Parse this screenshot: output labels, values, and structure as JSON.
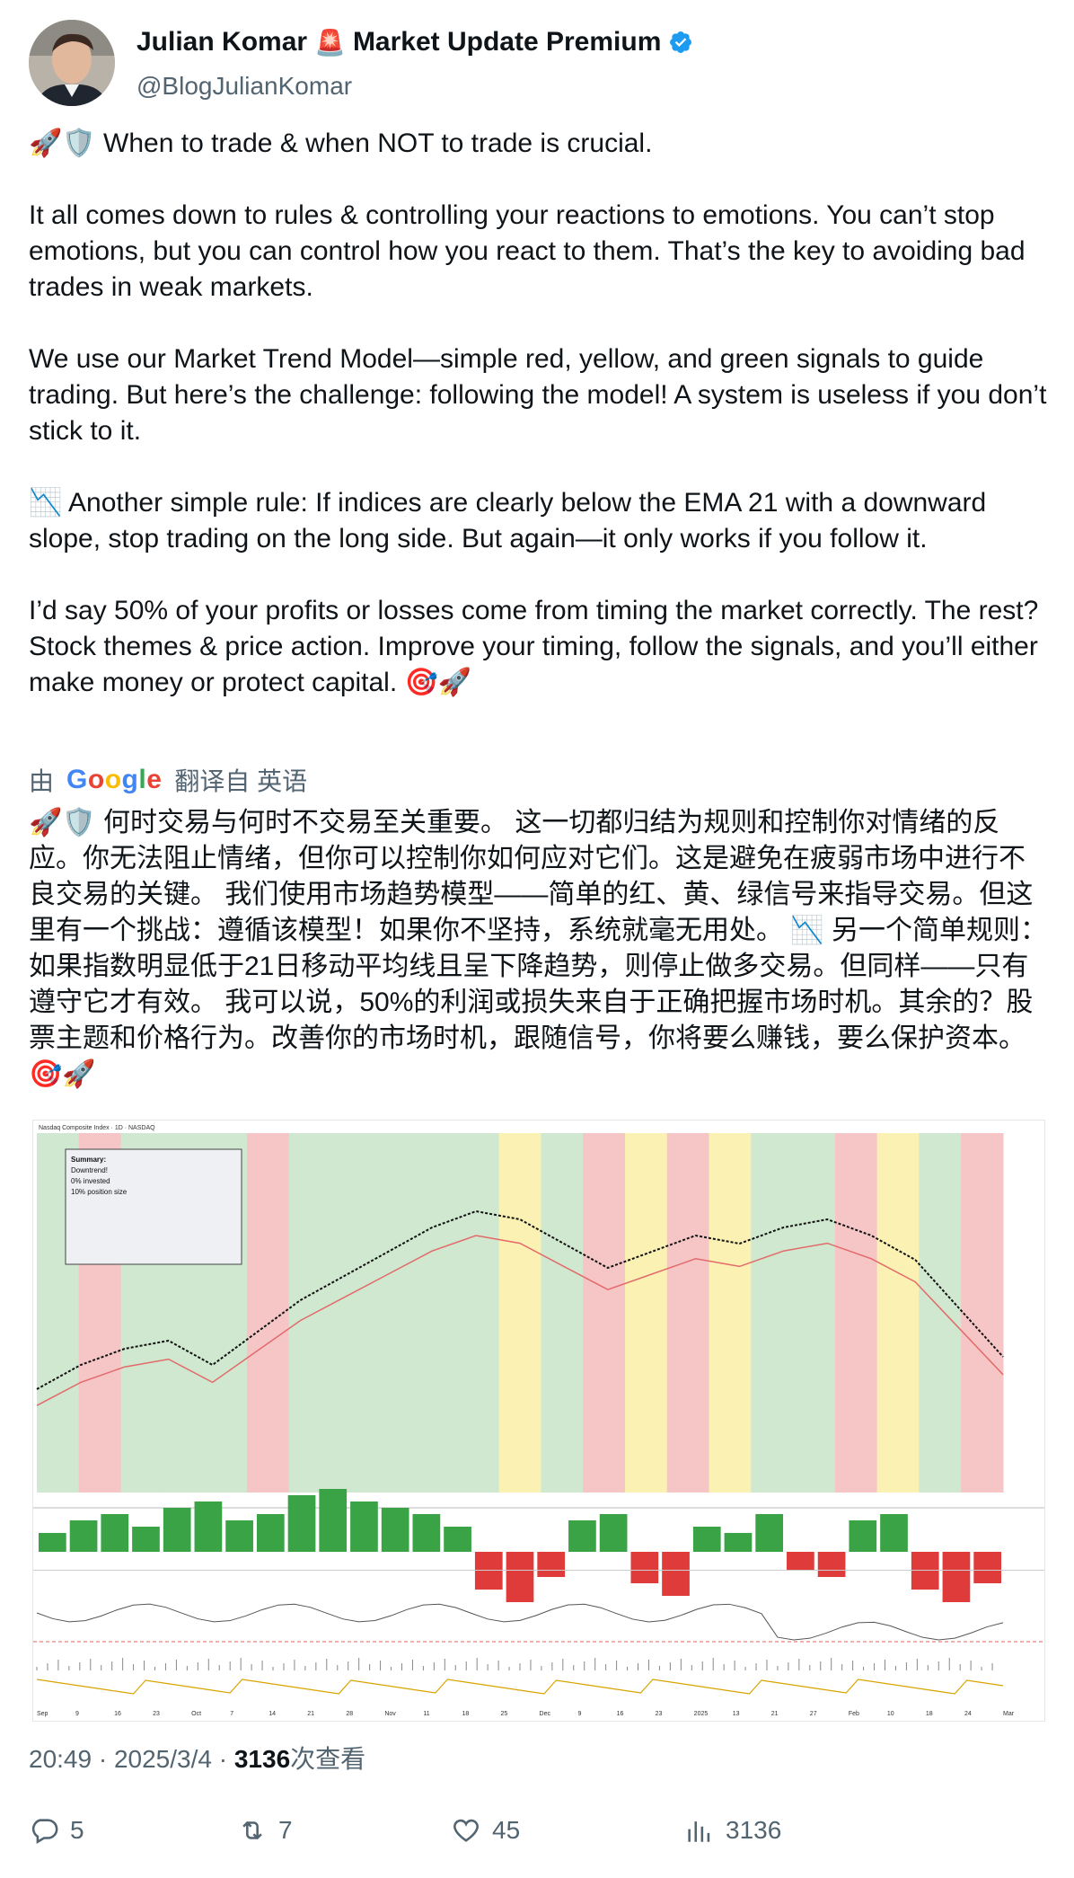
{
  "author": {
    "name": "Julian Komar",
    "name_suffix": "Market Update Premium",
    "emoji_icon": "🚨",
    "handle": "@BlogJulianKomar"
  },
  "post": {
    "paragraphs": [
      "🚀🛡️ When to trade & when NOT to trade is crucial.",
      "It all comes down to rules & controlling your reactions to emotions. You can’t stop emotions, but you can control how you react to them. That’s the key to avoiding bad trades in weak markets.",
      "We use our Market Trend Model—simple red, yellow, and green signals to guide trading. But here’s the challenge: following the model! A system is useless if you don’t stick to it.",
      "📉 Another simple rule: If indices are clearly below the EMA 21 with a downward slope, stop trading on the long side. But again—it only works if you follow it.",
      "I’d say 50% of your profits or losses come from timing the market correctly. The rest? Stock themes & price action. Improve your timing, follow the signals, and you’ll either make money or protect capital. 🎯🚀"
    ]
  },
  "translation": {
    "prefix": "由",
    "provider": "Google",
    "suffix": "翻译自 英语",
    "text": "🚀🛡️ 何时交易与何时不交易至关重要。 这一切都归结为规则和控制你对情绪的反应。你无法阻止情绪，但你可以控制你如何应对它们。这是避免在疲弱市场中进行不良交易的关键。 我们使用市场趋势模型——简单的红、黄、绿信号来指导交易。但这里有一个挑战：遵循该模型！如果你不坚持，系统就毫无用处。 📉 另一个简单规则：如果指数明显低于21日移动平均线且呈下降趋势，则停止做多交易。但同样——只有遵守它才有效。 我可以说，50%的利润或损失来自于正确把握市场时机。其余的？股票主题和价格行为。改善你的市场时机，跟随信号，你将要么赚钱，要么保护资本。🎯🚀"
  },
  "chart_image": {
    "title": "Nasdaq Composite Index · 1D · NASDAQ",
    "summary_lines": [
      "Summary:",
      "Downtrend!",
      "0% invested",
      "10% position size"
    ],
    "bands": [
      "green",
      "red",
      "green",
      "green",
      "green",
      "red",
      "green",
      "green",
      "green",
      "green",
      "green",
      "yellow",
      "green",
      "red",
      "yellow",
      "red",
      "yellow",
      "green",
      "green",
      "red",
      "yellow",
      "green",
      "red"
    ],
    "price_path": [
      17.9,
      18.2,
      18.4,
      18.5,
      18.2,
      18.6,
      19.0,
      19.3,
      19.6,
      19.9,
      20.1,
      20.0,
      19.7,
      19.4,
      19.6,
      19.8,
      19.7,
      19.9,
      20.0,
      19.8,
      19.5,
      18.9,
      18.3
    ],
    "bars": [
      3,
      5,
      6,
      4,
      7,
      8,
      5,
      6,
      9,
      10,
      8,
      7,
      6,
      4,
      -6,
      -8,
      -4,
      5,
      6,
      -5,
      -7,
      4,
      3,
      6,
      -3,
      -4,
      5,
      6,
      -6,
      -8,
      -5
    ],
    "x_labels": [
      "Sep",
      "9",
      "16",
      "23",
      "Oct",
      "7",
      "14",
      "21",
      "28",
      "Nov",
      "11",
      "18",
      "25",
      "Dec",
      "9",
      "16",
      "23",
      "2025",
      "13",
      "21",
      "27",
      "Feb",
      "10",
      "18",
      "24",
      "Mar"
    ],
    "colors": {
      "green": "#cfe8cf",
      "red": "#f6c6c6",
      "yellow": "#fbf1b3",
      "bar_green": "#3aa346",
      "bar_red": "#e03b3b",
      "price": "#111111",
      "ema": "#e36a6a"
    }
  },
  "meta": {
    "time": "20:49",
    "date": "2025/3/4",
    "views": "3136",
    "views_label": "次查看"
  },
  "actions": {
    "replies": "5",
    "reposts": "7",
    "likes": "45",
    "views": "3136"
  },
  "colors": {
    "verified": "#1d9bf0",
    "secondary_text": "#536471"
  }
}
